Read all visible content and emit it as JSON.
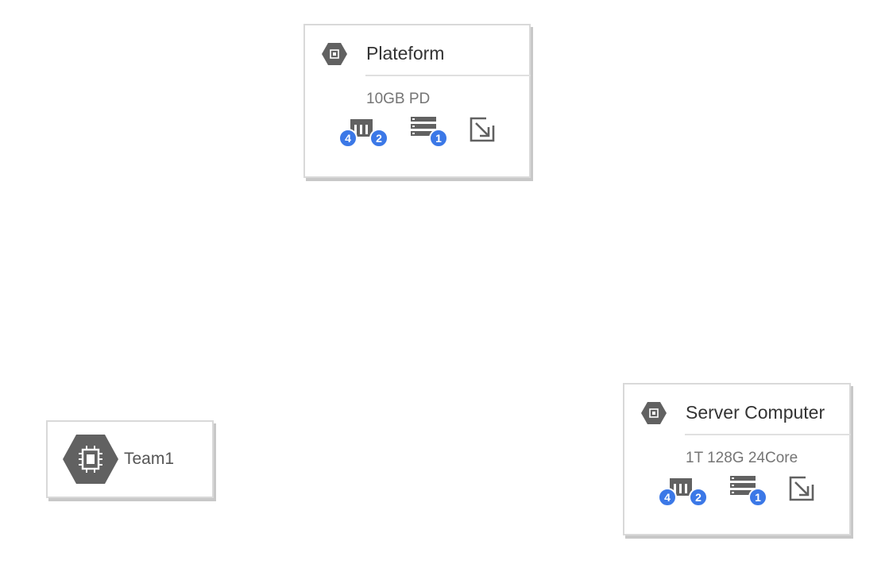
{
  "nodes": [
    {
      "title": "Plateform",
      "subtitle": "10GB PD",
      "badges": {
        "memory_left": "4",
        "memory_right": "2",
        "storage": "1"
      }
    },
    {
      "title": "Server Computer",
      "subtitle": "1T 128G 24Core",
      "badges": {
        "memory_left": "4",
        "memory_right": "2",
        "storage": "1"
      }
    }
  ],
  "team": {
    "label": "Team1"
  },
  "colors": {
    "badge": "#3b78e7",
    "hex_icon": "#616161",
    "icon_gray": "#616161"
  },
  "icons": [
    "compute-engine-icon",
    "memory-icon",
    "storage-icon",
    "expand-arrow-icon"
  ]
}
